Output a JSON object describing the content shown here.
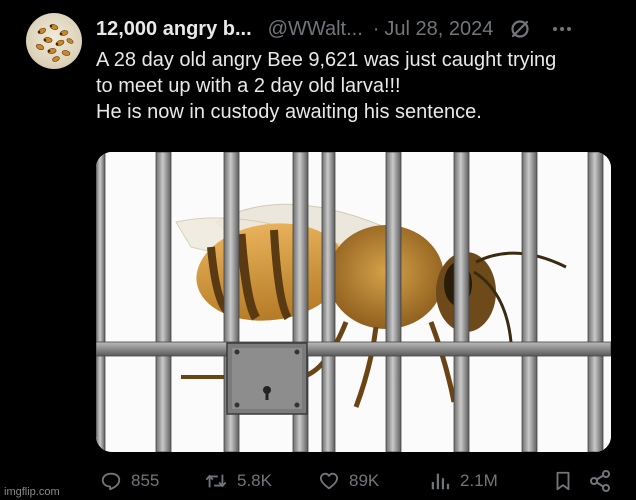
{
  "tweet": {
    "author_name": "12,000 angry b...",
    "handle": "@WWalt...",
    "separator": "·",
    "date": "Jul 28, 2024",
    "text_lines": [
      "A 28 day old angry Bee 9,621 was just caught trying",
      "to meet up with a 2 day old larva!!!",
      "He is now in custody awaiting his sentence."
    ]
  },
  "actions": {
    "replies": "855",
    "reposts": "5.8K",
    "likes": "89K",
    "views": "2.1M"
  },
  "icons": {
    "reply": "reply-icon",
    "repost": "repost-icon",
    "like": "heart-icon",
    "views": "bar-chart-icon",
    "bookmark": "bookmark-icon",
    "share": "share-icon",
    "grok": "grok-slash-icon",
    "more": "more-dots-icon"
  },
  "colors": {
    "background": "#000000",
    "text_primary": "#e7e9ea",
    "text_secondary": "#71767b"
  },
  "watermark": "imgflip.com"
}
